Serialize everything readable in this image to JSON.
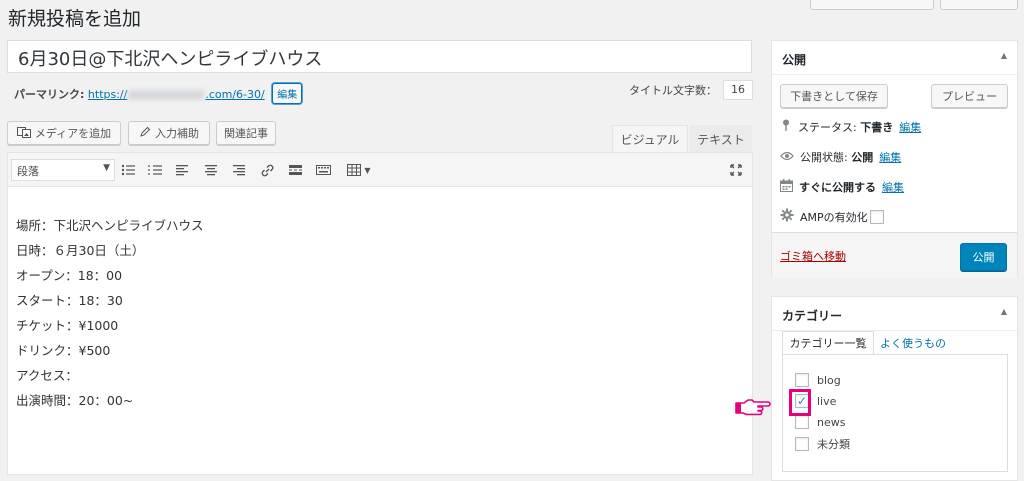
{
  "page": {
    "title": "新規投稿を追加"
  },
  "post": {
    "title": "6月30日@下北沢ヘンピライブハウス",
    "permalink_label": "パーマリンク:",
    "permalink_prefix": "https://",
    "permalink_suffix": ".com/6-30/",
    "permalink_edit": "編集",
    "title_count_label": "タイトル文字数：",
    "title_count": "16"
  },
  "toolbar": {
    "add_media": "メディアを追加",
    "input_assist": "入力補助",
    "related_posts": "関連記事",
    "tab_visual": "ビジュアル",
    "tab_text": "テキスト",
    "format_select": "段落"
  },
  "content": {
    "lines": [
      "場所：下北沢ヘンピライブハウス",
      "日時：６月30日（土）",
      "オープン：18：00",
      "スタート：18：30",
      "チケット：¥1000",
      "ドリンク：¥500",
      "アクセス：",
      "出演時間：20：00~"
    ]
  },
  "publish": {
    "header": "公開",
    "save_draft": "下書きとして保存",
    "preview": "プレビュー",
    "status_label": "ステータス: ",
    "status_value": "下書き",
    "status_edit": "編集",
    "visibility_label": "公開状態: ",
    "visibility_value": "公開",
    "visibility_edit": "編集",
    "schedule_label": "すぐに公開する",
    "schedule_edit": "編集",
    "amp_label": "AMPの有効化",
    "trash": "ゴミ箱へ移動",
    "publish_button": "公開"
  },
  "categories": {
    "header": "カテゴリー",
    "tab_all": "カテゴリー一覧",
    "tab_popular": "よく使うもの",
    "items": [
      {
        "label": "blog",
        "checked": false
      },
      {
        "label": "live",
        "checked": true
      },
      {
        "label": "news",
        "checked": false
      },
      {
        "label": "未分類",
        "checked": false
      }
    ]
  },
  "colors": {
    "accent": "#0073aa",
    "publish_button": "#0085ba",
    "highlight": "#e4007f",
    "trash": "#a00000"
  },
  "icons": {
    "add_media": "media-icon",
    "input_assist": "pencil-icon",
    "status": "pin-icon",
    "visibility": "eye-icon",
    "schedule": "calendar-icon",
    "amp": "gear-icon",
    "pointer": "pointing-hand-icon"
  }
}
